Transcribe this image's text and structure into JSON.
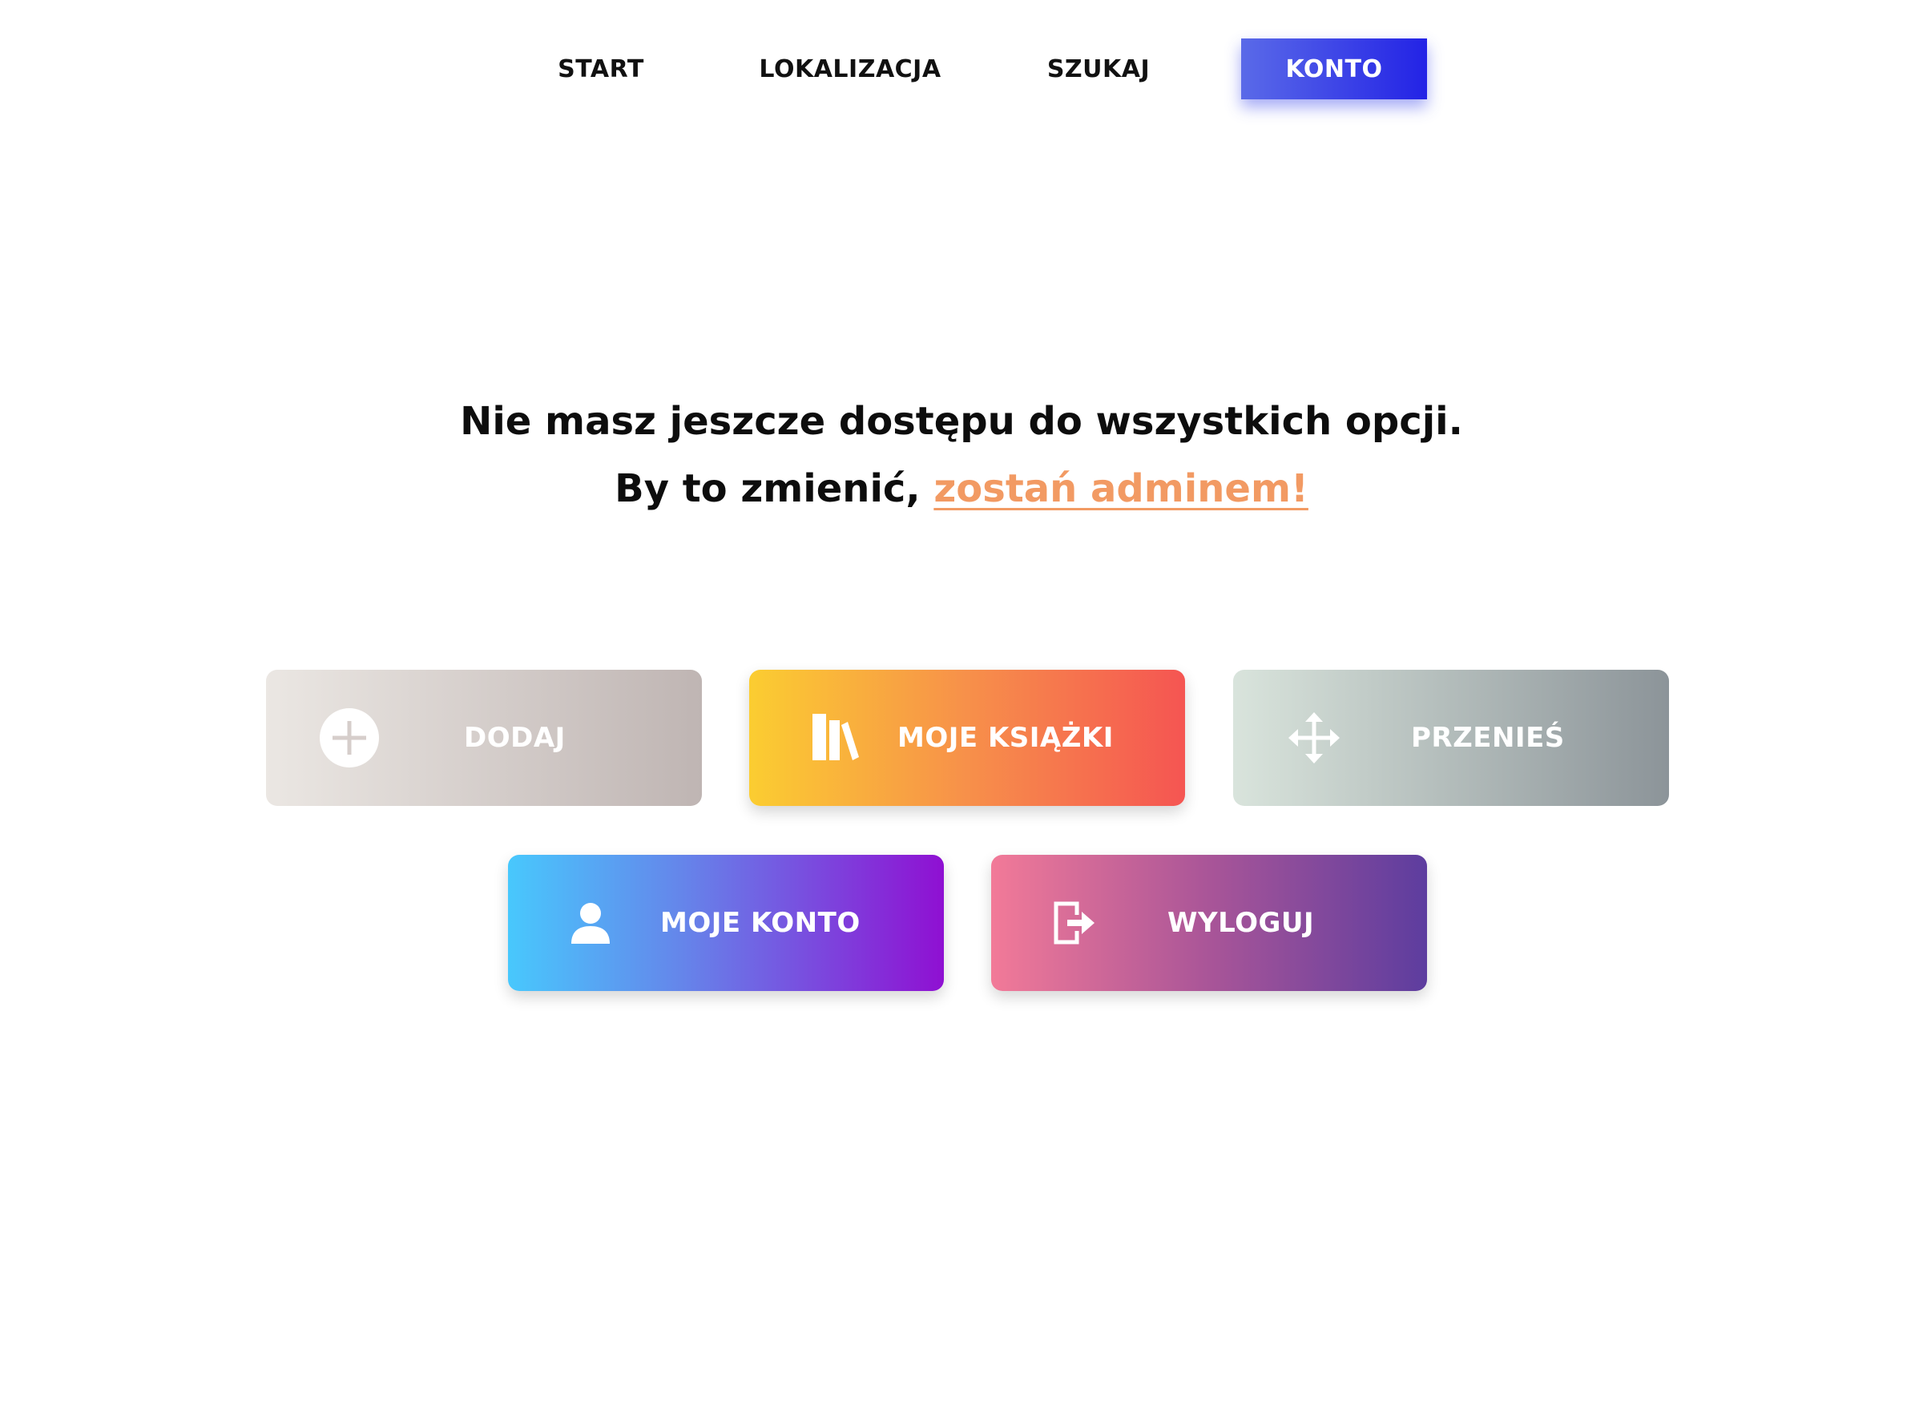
{
  "nav": {
    "items": [
      {
        "label": "START"
      },
      {
        "label": "LOKALIZACJA"
      },
      {
        "label": "SZUKAJ"
      },
      {
        "label": "KONTO",
        "active": true
      }
    ],
    "active_color": "#2323e6"
  },
  "message": {
    "line1": "Nie masz jeszcze dostępu do wszystkich opcji.",
    "line2_prefix": "By to zmienić,",
    "admin_link": "zostań adminem!",
    "link_color": "#f29a63"
  },
  "tiles": [
    {
      "label": "DODAJ",
      "icon": "plus-circle-icon",
      "enabled": false
    },
    {
      "label": "MOJE KSIĄŻKI",
      "icon": "books-icon",
      "enabled": true
    },
    {
      "label": "PRZENIEŚ",
      "icon": "move-arrows-icon",
      "enabled": false
    },
    {
      "label": "MOJE KONTO",
      "icon": "user-icon",
      "enabled": true
    },
    {
      "label": "WYLOGUJ",
      "icon": "logout-icon",
      "enabled": true
    }
  ]
}
